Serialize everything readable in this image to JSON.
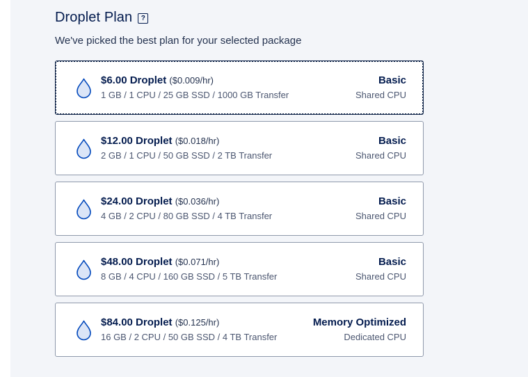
{
  "section": {
    "title": "Droplet Plan",
    "help_icon": "?",
    "subtitle": "We've picked the best plan for your selected package"
  },
  "plans": [
    {
      "price": "$6.00 Droplet",
      "hourly": "($0.009/hr)",
      "specs": "1 GB / 1 CPU / 25 GB SSD / 1000 GB Transfer",
      "type": "Basic",
      "cpu": "Shared CPU",
      "selected": true
    },
    {
      "price": "$12.00 Droplet",
      "hourly": "($0.018/hr)",
      "specs": "2 GB / 1 CPU / 50 GB SSD / 2 TB Transfer",
      "type": "Basic",
      "cpu": "Shared CPU",
      "selected": false
    },
    {
      "price": "$24.00 Droplet",
      "hourly": "($0.036/hr)",
      "specs": "4 GB / 2 CPU / 80 GB SSD / 4 TB Transfer",
      "type": "Basic",
      "cpu": "Shared CPU",
      "selected": false
    },
    {
      "price": "$48.00 Droplet",
      "hourly": "($0.071/hr)",
      "specs": "8 GB / 4 CPU / 160 GB SSD / 5 TB Transfer",
      "type": "Basic",
      "cpu": "Shared CPU",
      "selected": false
    },
    {
      "price": "$84.00 Droplet",
      "hourly": "($0.125/hr)",
      "specs": "16 GB / 2 CPU / 50 GB SSD / 4 TB Transfer",
      "type": "Memory Optimized",
      "cpu": "Dedicated CPU",
      "selected": false
    }
  ],
  "icons": {
    "plan_icon": "droplet-icon",
    "help": "help-icon"
  },
  "colors": {
    "text_primary": "#031b4e",
    "card_border": "#8f99ab",
    "panel_background": "#f3f5f9",
    "droplet_fill": "#dbe5f7",
    "droplet_stroke": "#0047bb"
  }
}
